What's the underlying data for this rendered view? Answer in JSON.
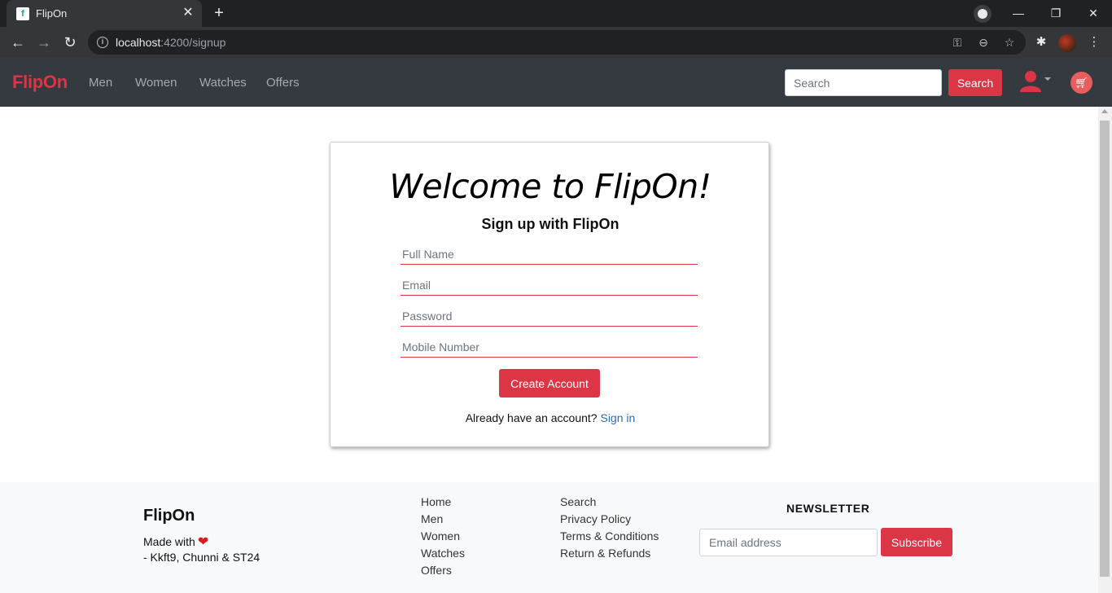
{
  "browser": {
    "tab_title": "FlipOn",
    "tab_favicon": "f",
    "url_host": "localhost",
    "url_rest": ":4200/signup"
  },
  "navbar": {
    "brand": "FlipOn",
    "links": [
      "Men",
      "Women",
      "Watches",
      "Offers"
    ],
    "search_placeholder": "Search",
    "search_button": "Search"
  },
  "signup": {
    "welcome": "Welcome to FlipOn!",
    "subtitle": "Sign up with FlipOn",
    "fields": {
      "full_name": "Full Name",
      "email": "Email",
      "password": "Password",
      "mobile": "Mobile Number"
    },
    "create_button": "Create Account",
    "already_text": "Already have an account?",
    "signin_link": "Sign in"
  },
  "footer": {
    "brand": "FlipOn",
    "made_with": "Made with",
    "authors": "- Kkft9, Chunni & ST24",
    "links_col1": [
      "Home",
      "Men",
      "Women",
      "Watches",
      "Offers"
    ],
    "links_col2": [
      "Search",
      "Privacy Policy",
      "Terms & Conditions",
      "Return & Refunds"
    ],
    "newsletter_title": "NEWSLETTER",
    "email_placeholder": "Email address",
    "subscribe_button": "Subscribe"
  },
  "colors": {
    "accent": "#dc3545",
    "navbar_bg": "#343a40",
    "footer_bg": "#f8f9fa"
  }
}
